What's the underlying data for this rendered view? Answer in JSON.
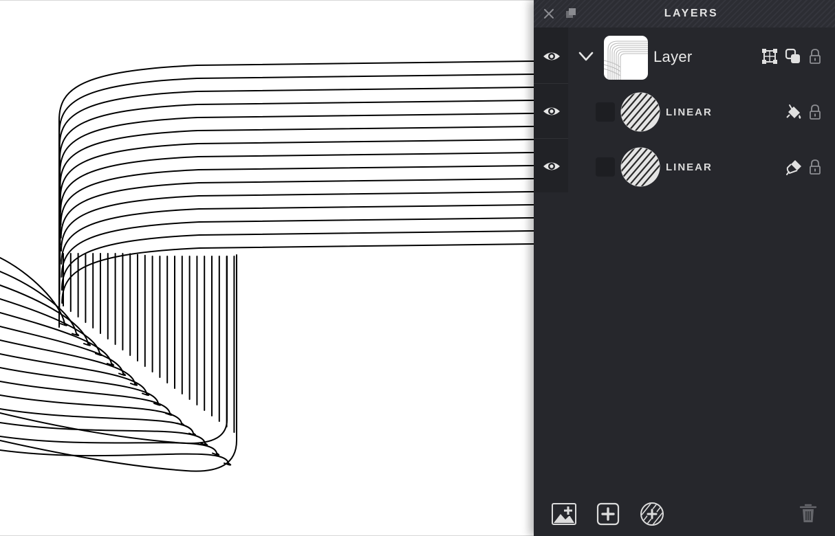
{
  "panel": {
    "title": "LAYERS"
  },
  "layers": [
    {
      "name": "Layer",
      "kind": "group",
      "visible": true,
      "expanded": true,
      "icons": [
        "transform-icon",
        "blend-mode-icon",
        "lock-icon"
      ]
    },
    {
      "name": "LINEAR",
      "kind": "linear-effect",
      "visible": true,
      "icons": [
        "paint-bucket-icon",
        "lock-icon"
      ]
    },
    {
      "name": "LINEAR",
      "kind": "linear-effect",
      "visible": true,
      "icons": [
        "paint-brush-icon",
        "lock-icon"
      ]
    }
  ],
  "footer": {
    "buttons": [
      "add-image-icon",
      "add-layer-icon",
      "add-effect-icon"
    ],
    "delete": "trash-icon"
  },
  "colors": {
    "panel_bg": "#26272c",
    "eye_column_bg": "#212226",
    "text": "#e6e6e6",
    "canvas_bg": "#ffffff",
    "stroke": "#000000"
  }
}
